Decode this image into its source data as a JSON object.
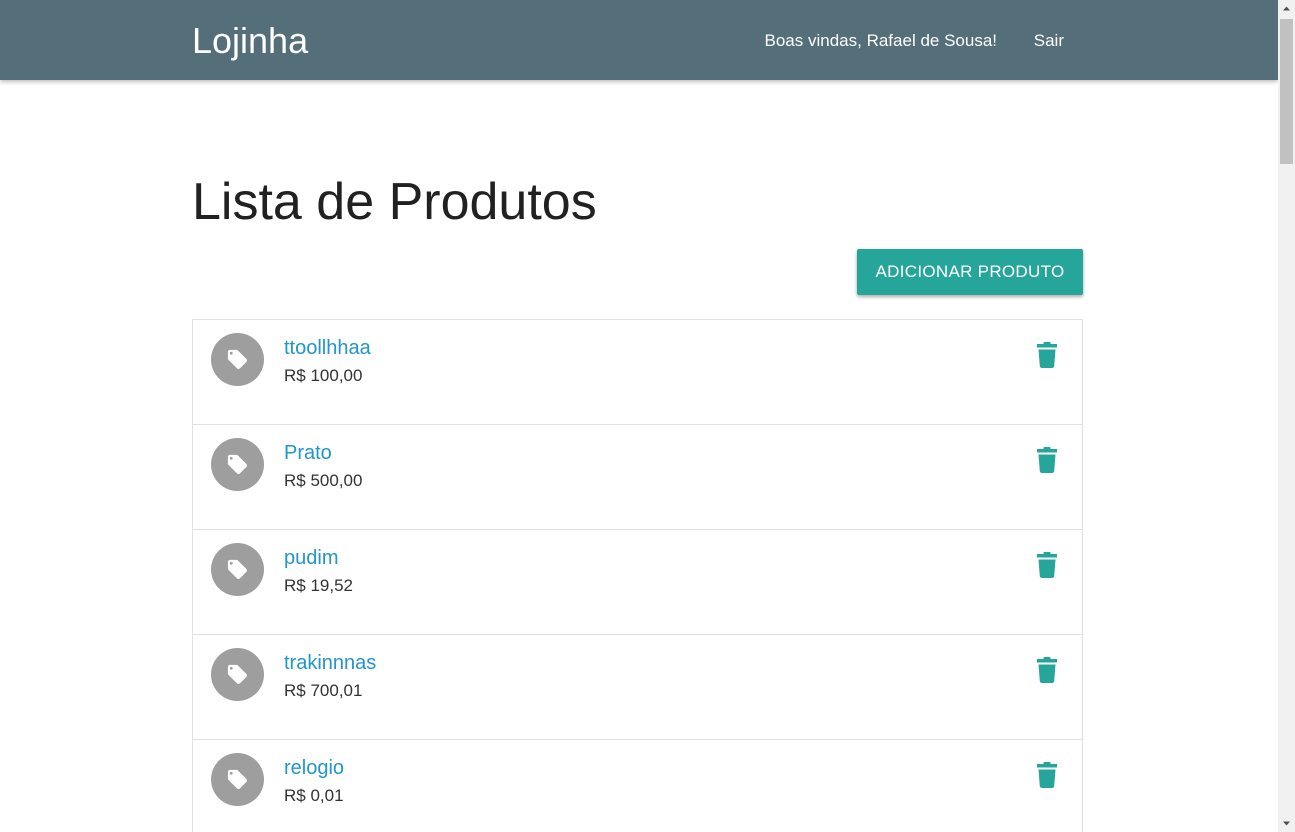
{
  "navbar": {
    "brand": "Lojinha",
    "welcome": "Boas vindas, Rafael de Sousa!",
    "logout": "Sair"
  },
  "main": {
    "title": "Lista de Produtos",
    "add_button": "ADICIONAR PRODUTO"
  },
  "products": [
    {
      "name": "ttoollhhaa",
      "price": "R$ 100,00"
    },
    {
      "name": "Prato",
      "price": "R$ 500,00"
    },
    {
      "name": "pudim",
      "price": "R$ 19,52"
    },
    {
      "name": "trakinnnas",
      "price": "R$ 700,01"
    },
    {
      "name": "relogio",
      "price": "R$ 0,01"
    }
  ],
  "icons": {
    "avatar": "tag-icon",
    "delete": "trash-icon"
  },
  "colors": {
    "navbar": "#546e7a",
    "accent": "#26a69a",
    "link": "#2196c9",
    "avatar_bg": "#9e9e9e"
  }
}
